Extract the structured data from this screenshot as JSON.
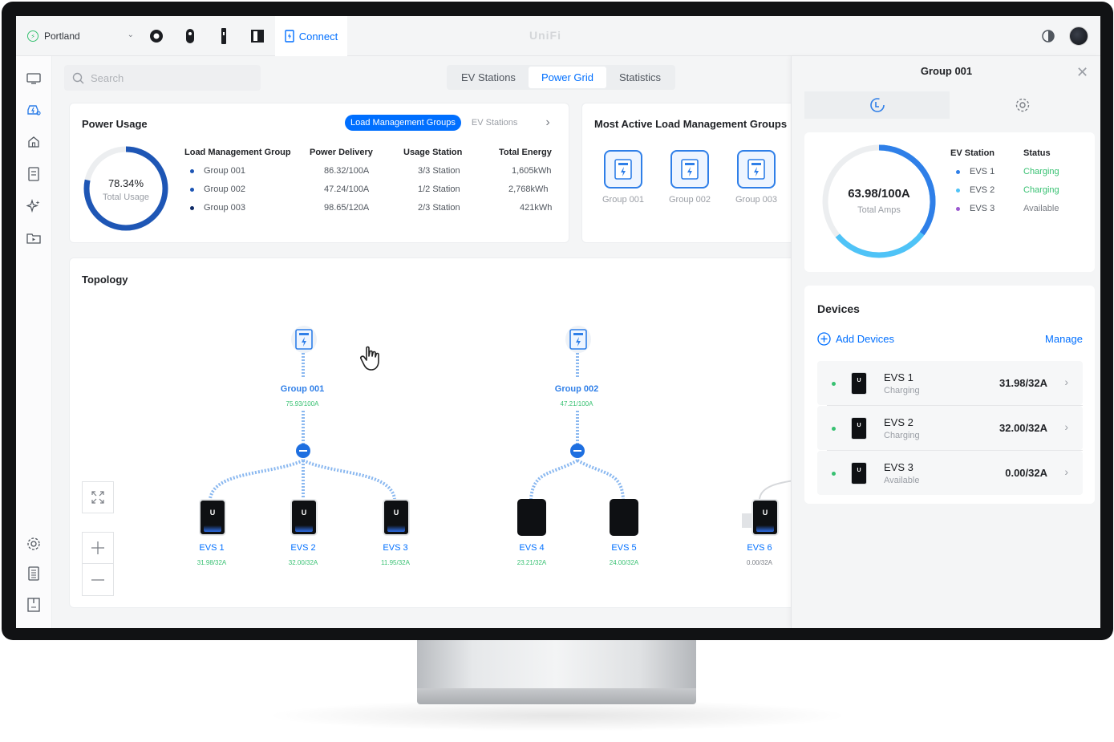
{
  "topbar": {
    "site": "Portland",
    "active_app": "Connect",
    "brand": "UniFi"
  },
  "search": {
    "placeholder": "Search"
  },
  "view_tabs": [
    "EV Stations",
    "Power Grid",
    "Statistics"
  ],
  "active_view_tab": "Power Grid",
  "power_usage": {
    "title": "Power Usage",
    "tabs": [
      "Load Management Groups",
      "EV Stations"
    ],
    "active_tab": "Load Management Groups",
    "percent": "78.34%",
    "percent_value": 78.34,
    "percent_caption": "Total Usage",
    "headers": [
      "Load Management Group",
      "Power Delivery",
      "Usage Station",
      "Total Energy"
    ],
    "rows": [
      {
        "group": "Group 001",
        "delivery": "86.32/100A",
        "usage": "3/3 Station",
        "energy": "1,605kWh"
      },
      {
        "group": "Group 002",
        "delivery": "47.24/100A",
        "usage": "1/2 Station",
        "energy": "2,768kWh"
      },
      {
        "group": "Group 003",
        "delivery": "98.65/120A",
        "usage": "2/3 Station",
        "energy": "421kWh"
      }
    ]
  },
  "most_active": {
    "title": "Most Active Load Management Groups",
    "groups": [
      "Group 001",
      "Group 002",
      "Group 003"
    ]
  },
  "topology": {
    "title": "Topology",
    "groups": [
      {
        "name": "Group 001",
        "amps": "75.93/100A"
      },
      {
        "name": "Group 002",
        "amps": "47.21/100A"
      }
    ],
    "stations": [
      {
        "name": "EVS 1",
        "amps": "31.98/32A"
      },
      {
        "name": "EVS 2",
        "amps": "32.00/32A"
      },
      {
        "name": "EVS 3",
        "amps": "11.95/32A"
      },
      {
        "name": "EVS 4",
        "amps": "23.21/32A"
      },
      {
        "name": "EVS 5",
        "amps": "24.00/32A"
      },
      {
        "name": "EVS 6",
        "amps": "0.00/32A"
      }
    ]
  },
  "panel": {
    "title": "Group 001",
    "total_amps": "63.98/100A",
    "total_amps_fraction": 0.6398,
    "total_amps_caption": "Total Amps",
    "status_headers": [
      "EV Station",
      "Status"
    ],
    "status_rows": [
      {
        "station": "EVS 1",
        "status": "Charging",
        "color": "#2f7fe8"
      },
      {
        "station": "EVS 2",
        "status": "Charging",
        "color": "#4fc3f7"
      },
      {
        "station": "EVS 3",
        "status": "Available",
        "color": "#9b59d0"
      }
    ],
    "devices_title": "Devices",
    "add_devices": "Add Devices",
    "manage": "Manage",
    "devices": [
      {
        "name": "EVS 1",
        "state": "Charging",
        "amps": "31.98/32A"
      },
      {
        "name": "EVS 2",
        "state": "Charging",
        "amps": "32.00/32A"
      },
      {
        "name": "EVS 3",
        "state": "Available",
        "amps": "0.00/32A"
      }
    ]
  },
  "colors": {
    "accent": "#006fff",
    "success": "#38c172",
    "ring_dark": "#1e56b5"
  }
}
